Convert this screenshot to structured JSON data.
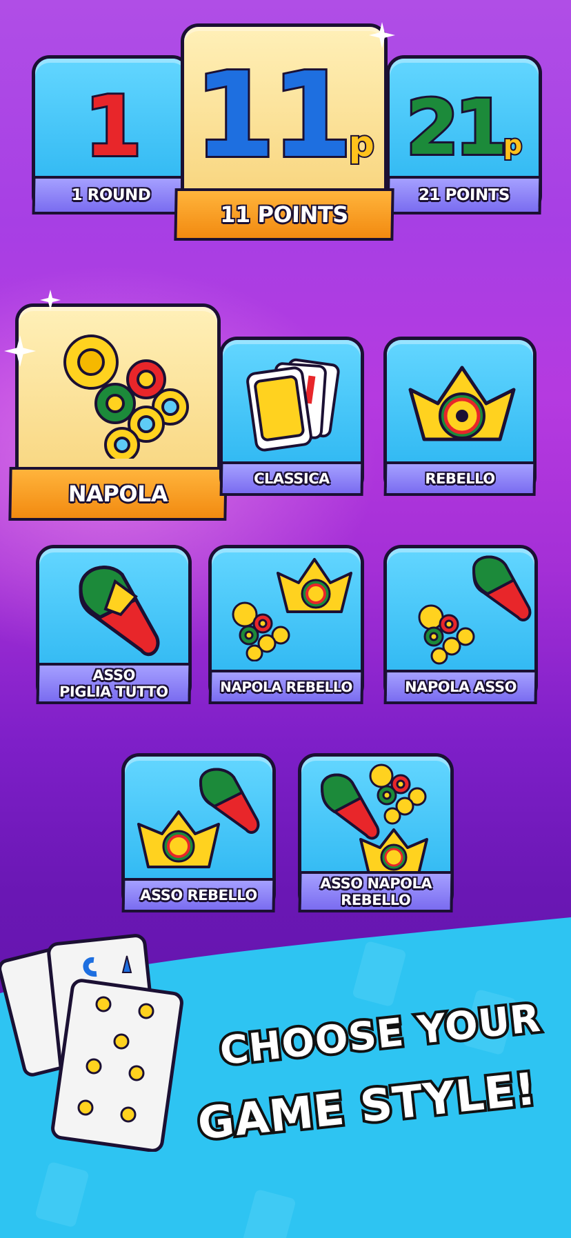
{
  "rounds": {
    "one_round": {
      "number": "1",
      "label": "1 ROUND",
      "color": "#e8262a"
    },
    "eleven_points": {
      "number": "11",
      "suffix": "p",
      "label": "11 POINTS",
      "color": "#1e6fe0"
    },
    "twentyone_points": {
      "number": "21",
      "suffix": "p",
      "label": "21 POINTS",
      "color": "#1c8a3a"
    }
  },
  "modes": {
    "napola": {
      "label": "NAPOLA",
      "icon": "coins-icon"
    },
    "classica": {
      "label": "CLASSICA",
      "icon": "cards-icon"
    },
    "rebello": {
      "label": "REBELLO",
      "icon": "crown-icon"
    },
    "asso_piglia_tutto": {
      "label": "ASSO\nPIGLIA TUTTO",
      "line1": "ASSO",
      "line2": "PIGLIA TUTTO",
      "icon": "club-icon"
    },
    "napola_rebello": {
      "label": "NAPOLA REBELLO",
      "icon": "coins-crown-icon"
    },
    "napola_asso": {
      "label": "NAPOLA ASSO",
      "icon": "coins-club-icon"
    },
    "asso_rebello": {
      "label": "ASSO REBELLO",
      "icon": "club-crown-icon"
    },
    "asso_napola_rebello": {
      "label": "ASSO NAPOLA\nREBELLO",
      "line1": "ASSO NAPOLA",
      "line2": "REBELLO",
      "icon": "club-coins-crown-icon"
    }
  },
  "footer": {
    "line1": "CHOOSE YOUR",
    "line2": "GAME STYLE!"
  },
  "colors": {
    "accent_orange": "#f28a10",
    "tile_blue": "#27b3f0",
    "ribbon_purple": "#7a6cf0"
  }
}
